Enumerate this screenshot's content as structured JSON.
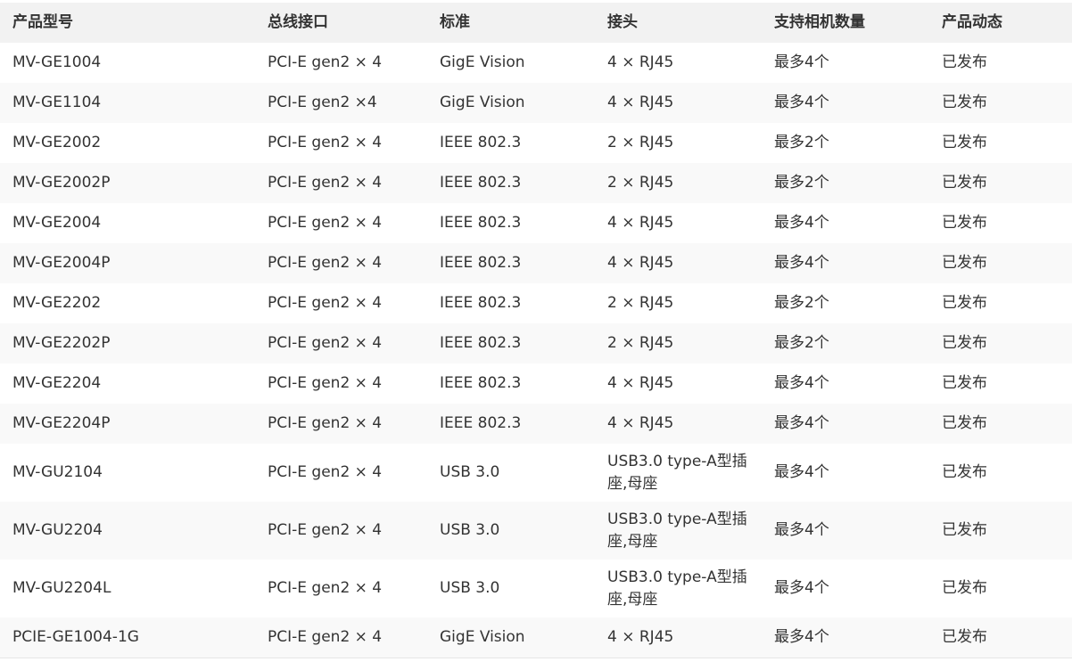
{
  "table": {
    "headers": {
      "model": "产品型号",
      "bus": "总线接口",
      "standard": "标准",
      "connector": "接头",
      "cameras": "支持相机数量",
      "status": "产品动态"
    },
    "rows": [
      {
        "model": "MV-GE1004",
        "bus": "PCI-E gen2 × 4",
        "standard": "GigE Vision",
        "connector": "4 × RJ45",
        "cameras": "最多4个",
        "status": "已发布"
      },
      {
        "model": "MV-GE1104",
        "bus": "PCI-E gen2 ×4",
        "standard": "GigE Vision",
        "connector": "4 × RJ45",
        "cameras": "最多4个",
        "status": "已发布"
      },
      {
        "model": "MV-GE2002",
        "bus": "PCI-E gen2 × 4",
        "standard": "IEEE 802.3",
        "connector": "2 × RJ45",
        "cameras": "最多2个",
        "status": "已发布"
      },
      {
        "model": "MV-GE2002P",
        "bus": "PCI-E gen2 × 4",
        "standard": "IEEE 802.3",
        "connector": "2 × RJ45",
        "cameras": "最多2个",
        "status": "已发布"
      },
      {
        "model": "MV-GE2004",
        "bus": "PCI-E gen2 × 4",
        "standard": "IEEE 802.3",
        "connector": "4 × RJ45",
        "cameras": "最多4个",
        "status": "已发布"
      },
      {
        "model": "MV-GE2004P",
        "bus": "PCI-E gen2 × 4",
        "standard": "IEEE 802.3",
        "connector": "4 × RJ45",
        "cameras": "最多4个",
        "status": "已发布"
      },
      {
        "model": "MV-GE2202",
        "bus": "PCI-E gen2 × 4",
        "standard": "IEEE 802.3",
        "connector": "2 × RJ45",
        "cameras": "最多2个",
        "status": "已发布"
      },
      {
        "model": "MV-GE2202P",
        "bus": "PCI-E gen2 × 4",
        "standard": "IEEE 802.3",
        "connector": "2 × RJ45",
        "cameras": "最多2个",
        "status": "已发布"
      },
      {
        "model": "MV-GE2204",
        "bus": "PCI-E gen2 × 4",
        "standard": "IEEE 802.3",
        "connector": "4 × RJ45",
        "cameras": "最多4个",
        "status": "已发布"
      },
      {
        "model": "MV-GE2204P",
        "bus": "PCI-E gen2 × 4",
        "standard": "IEEE 802.3",
        "connector": "4 × RJ45",
        "cameras": "最多4个",
        "status": "已发布"
      },
      {
        "model": "MV-GU2104",
        "bus": "PCI-E gen2 × 4",
        "standard": "USB 3.0",
        "connector": "USB3.0 type-A型插座,母座",
        "cameras": "最多4个",
        "status": "已发布"
      },
      {
        "model": "MV-GU2204",
        "bus": "PCI-E gen2 × 4",
        "standard": "USB 3.0",
        "connector": "USB3.0 type-A型插座,母座",
        "cameras": "最多4个",
        "status": "已发布"
      },
      {
        "model": "MV-GU2204L",
        "bus": "PCI-E gen2 × 4",
        "standard": "USB 3.0",
        "connector": "USB3.0 type-A型插座,母座",
        "cameras": "最多4个",
        "status": "已发布"
      },
      {
        "model": "PCIE-GE1004-1G",
        "bus": "PCI-E gen2 × 4",
        "standard": "GigE Vision",
        "connector": "4 × RJ45",
        "cameras": "最多4个",
        "status": "已发布"
      }
    ]
  }
}
